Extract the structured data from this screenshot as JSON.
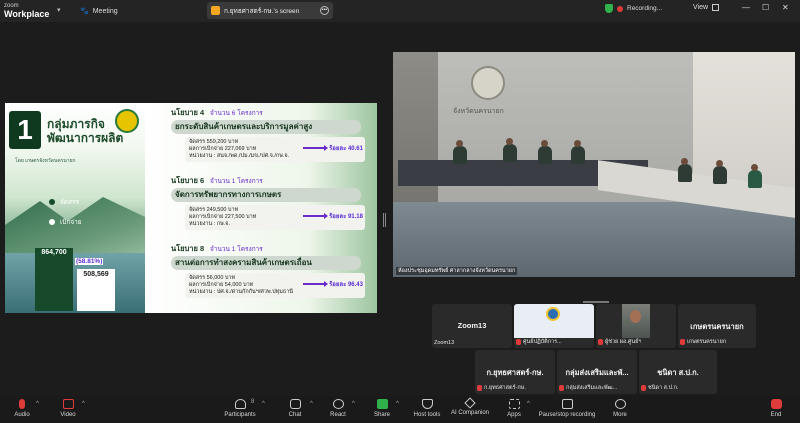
{
  "app": {
    "logo_top": "zoom",
    "logo_bottom": "Workplace",
    "meeting_label": "Meeting",
    "share_tab_label": "ก.ยุทธศาสตร์-กษ.'s screen",
    "recording_label": "Recording...",
    "view_label": "View"
  },
  "slide": {
    "number": "1",
    "group_title_line1": "กลุ่มภารกิจ",
    "group_title_line2": "พัฒนาการผลิต",
    "group_subtitle": "โดย เกษตรจังหวัดนครนายก",
    "legend_allocated": "จัดสรร",
    "legend_disbursed": "เบิกจ่าย",
    "value_allocated": "864,700",
    "value_disbursed": "508,569",
    "percent": "(58.81%)",
    "colors": {
      "allocated": "#164a2b",
      "disbursed": "#ffffff",
      "accent": "#5a2bd8"
    },
    "policies": [
      {
        "label": "นโยบาย 4",
        "count": "จำนวน  6  โครงการ",
        "title": "ยกระดับสินค้าเกษตรและบริการมูลค่าสูง",
        "line1": "จัดสรร 559,200 บาท",
        "line2": "ผลการเบิกจ่าย 227,069 บาท",
        "line3": "หน่วยงาน : สนจ./พด./ปม./มข./ปศ.จ./กษ.จ.",
        "percent": "ร้อยละ 40.61"
      },
      {
        "label": "นโยบาย 6",
        "count": "จำนวน  1  โครงการ",
        "title": "จัดการทรัพยากรทางการเกษตร",
        "line1": "จัดสรร 249,500 บาท",
        "line2": "ผลการเบิกจ่าย 227,500 บาท",
        "line3": "หน่วยงาน : กษ.จ.",
        "percent": "ร้อยละ 91.18"
      },
      {
        "label": "นโยบาย 8",
        "count": "จำนวน  1  โครงการ",
        "title": "สานต่อการทำสงครามสินค้าเกษตรเถื่อน",
        "line1": "จัดสรร 56,000 บาท",
        "line2": "ผลการเบิกจ่าย 54,000 บาท",
        "line3": "หน่วยงาน : ปศ.จ./ด่านกักกันฯ/ศวพ.ปทุมธานี",
        "percent": "ร้อยละ 96.43"
      }
    ]
  },
  "video": {
    "sign_text": "จังหวัดนครนายก",
    "caption": "ห้องประชุมอุดมทรัพย์ ศาลากลางจังหวัดนครนายก"
  },
  "participants": [
    {
      "name": "Zoom13",
      "caption": "Zoom13",
      "muted": false
    },
    {
      "name": "",
      "caption": "ศูนย์ปฏิบัติการ...",
      "muted": true
    },
    {
      "name": "",
      "caption": "ผู้ช่วย ผอ.ศูนย์ฯ",
      "muted": true
    },
    {
      "name": "เกษตรนครนายก",
      "caption": "เกษตรนครนายก",
      "muted": true
    },
    {
      "name": "ก.ยุทธศาสตร์-กษ.",
      "caption": "ก.ยุทธศาสตร์-กษ.",
      "muted": true
    },
    {
      "name": "กลุ่มส่งเสริมและพั...",
      "caption": "กลุ่มส่งเสริมและพัฒ...",
      "muted": true
    },
    {
      "name": "ชนิดา ส.ป.ก.",
      "caption": "ชนิดา ส.ป.ก.",
      "muted": true
    }
  ],
  "toolbar": {
    "audio": "Audio",
    "video": "Video",
    "participants": "Participants",
    "participants_count": "8",
    "chat": "Chat",
    "react": "React",
    "share": "Share",
    "host_tools": "Host tools",
    "ai_companion": "AI Companion",
    "apps": "Apps",
    "pause_recording": "Pause/stop recording",
    "more": "More",
    "end": "End"
  }
}
